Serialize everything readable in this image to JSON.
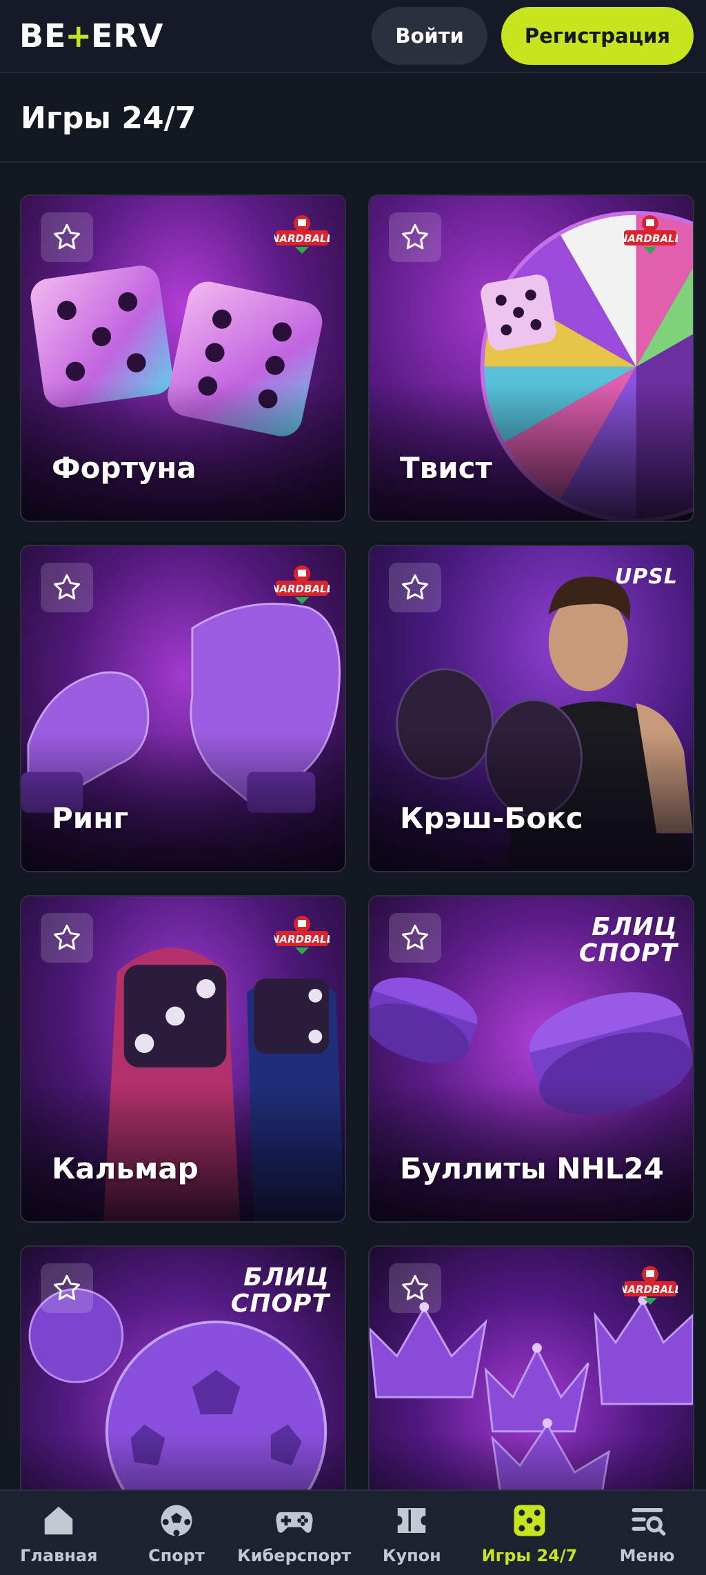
{
  "header": {
    "logo": {
      "left": "BE",
      "mid": "+",
      "right": "ERV"
    },
    "login_label": "Войти",
    "register_label": "Регистрация",
    "accent_color": "#c6e51d"
  },
  "page": {
    "title": "Игры 24/7"
  },
  "games": [
    {
      "title": "Фортуна",
      "provider": "NARDBALL",
      "art": "dice"
    },
    {
      "title": "Твист",
      "provider": "NARDBALL",
      "art": "wheel"
    },
    {
      "title": "Ринг",
      "provider": "NARDBALL",
      "art": "gloves"
    },
    {
      "title": "Крэш-Бокс",
      "provider": "UPSL",
      "art": "boxer"
    },
    {
      "title": "Кальмар",
      "provider": "NARDBALL",
      "art": "squid"
    },
    {
      "title": "Буллиты NHL24",
      "provider": "БЛИЦ СПОРТ",
      "art": "pucks"
    },
    {
      "title": "",
      "provider": "БЛИЦ СПОРТ",
      "art": "balls"
    },
    {
      "title": "",
      "provider": "NARDBALL",
      "art": "crowns"
    }
  ],
  "brands": {
    "blitz_line1": "БЛИЦ",
    "blitz_line2": "СПОРТ",
    "upsl": "UPSL",
    "nardball": "NARDBALL"
  },
  "bottom_nav": {
    "items": [
      {
        "label": "Главная",
        "icon": "home-icon"
      },
      {
        "label": "Спорт",
        "icon": "soccer-ball-icon"
      },
      {
        "label": "Киберспорт",
        "icon": "gamepad-icon"
      },
      {
        "label": "Купон",
        "icon": "coupon-icon"
      },
      {
        "label": "Игры 24/7",
        "icon": "dice-icon",
        "active": true
      },
      {
        "label": "Меню",
        "icon": "menu-search-icon"
      }
    ]
  }
}
